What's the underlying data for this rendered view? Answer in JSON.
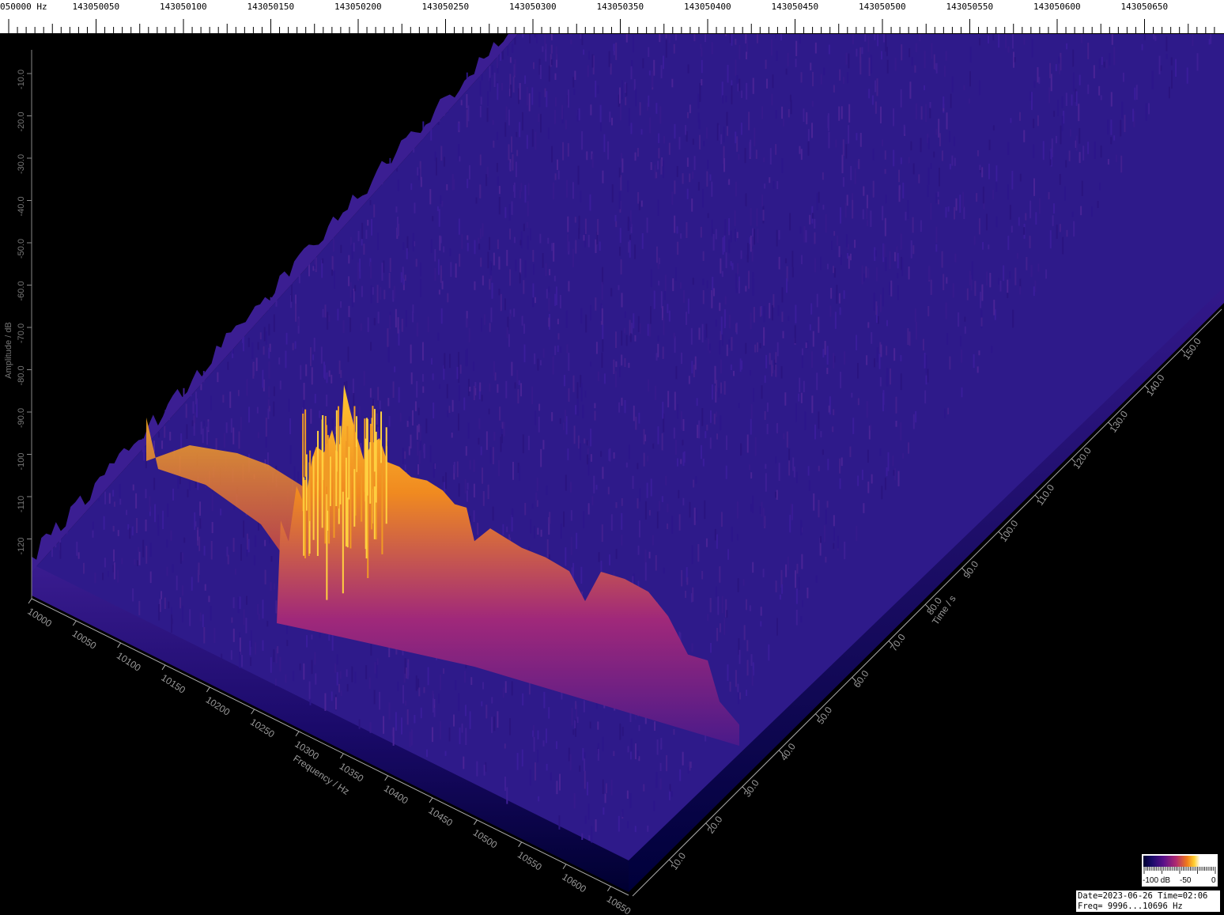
{
  "ruler": {
    "labels": [
      "050000 Hz",
      "143050050",
      "143050100",
      "143050150",
      "143050200",
      "143050250",
      "143050300",
      "143050350",
      "143050400",
      "143050450",
      "143050500",
      "143050550",
      "143050600",
      "143050650"
    ]
  },
  "axes": {
    "amplitude_label": "Amplitude / dB",
    "amplitude_ticks": [
      "-10.0",
      "-20.0",
      "-30.0",
      "-40.0",
      "-50.0",
      "-60.0",
      "-70.0",
      "-80.0",
      "-90.0",
      "-100",
      "-110",
      "-120"
    ],
    "frequency_label": "Frequency / Hz",
    "frequency_ticks": [
      "10000",
      "10050",
      "10100",
      "10150",
      "10200",
      "10250",
      "10300",
      "10350",
      "10400",
      "10450",
      "10500",
      "10550",
      "10600",
      "10650"
    ],
    "time_label": "Time / s",
    "time_ticks": [
      "10.0",
      "20.0",
      "30.0",
      "40.0",
      "50.0",
      "60.0",
      "70.0",
      "80.0",
      "90.0",
      "100.0",
      "110.0",
      "120.0",
      "130.0",
      "140.0",
      "150.0"
    ]
  },
  "legend": {
    "tick_min": "-100 dB",
    "tick_mid": "-50",
    "tick_max": "0"
  },
  "info": {
    "line1": "Date=2023-06-26 Time=02:06",
    "line2": "Freq= 9996...10696 Hz"
  },
  "colors": {
    "noise": "#3a1c90",
    "floor": "#000040",
    "signal_mid": "#a0287a",
    "signal_peak": "#ffb020"
  }
}
